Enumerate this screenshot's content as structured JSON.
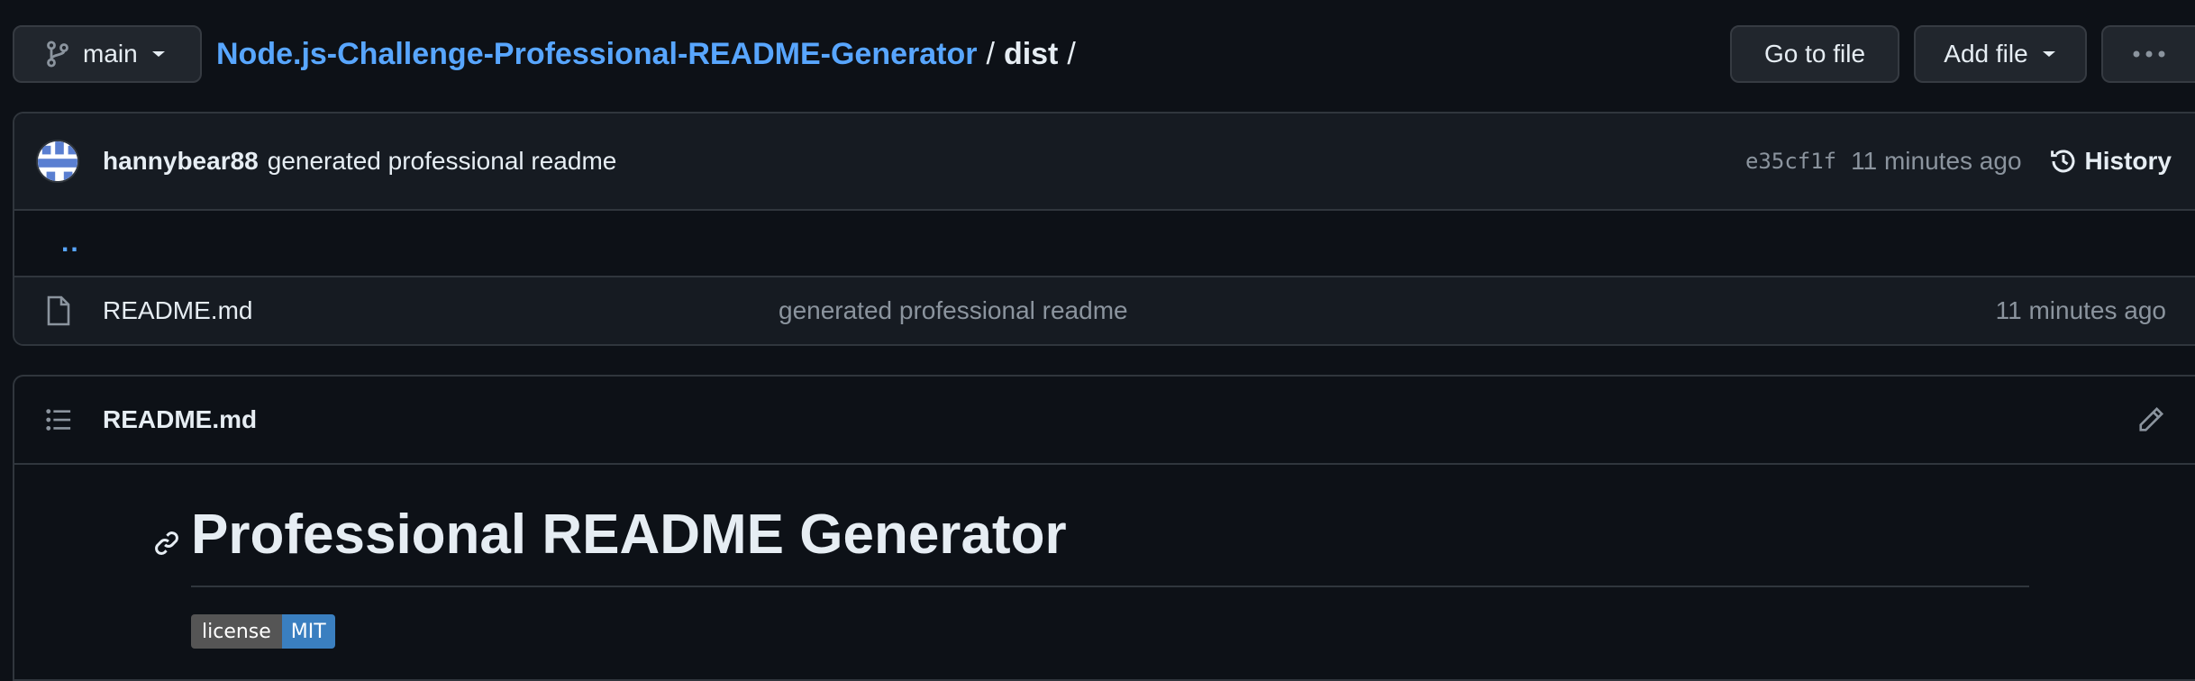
{
  "toolbar": {
    "branch_label": "main",
    "goto_file_label": "Go to file",
    "add_file_label": "Add file"
  },
  "breadcrumb": {
    "repo": "Node.js-Challenge-Professional-README-Generator",
    "sep1": "/",
    "dir": "dist",
    "sep2": "/"
  },
  "latest_commit": {
    "author": "hannybear88",
    "message": "generated professional readme",
    "sha": "e35cf1f",
    "time": "11 minutes ago",
    "history_label": "History"
  },
  "parent_dir": "..",
  "files": [
    {
      "name": "README.md",
      "commit_message": "generated professional readme",
      "time": "11 minutes ago"
    }
  ],
  "readme": {
    "filename": "README.md",
    "heading": "Professional README Generator",
    "badge": {
      "label": "license",
      "value": "MIT",
      "value_color": "#3a7fc0"
    }
  },
  "colors": {
    "background": "#0d1117",
    "link": "#58a6ff",
    "muted": "#8b949e",
    "border": "#30363d"
  }
}
